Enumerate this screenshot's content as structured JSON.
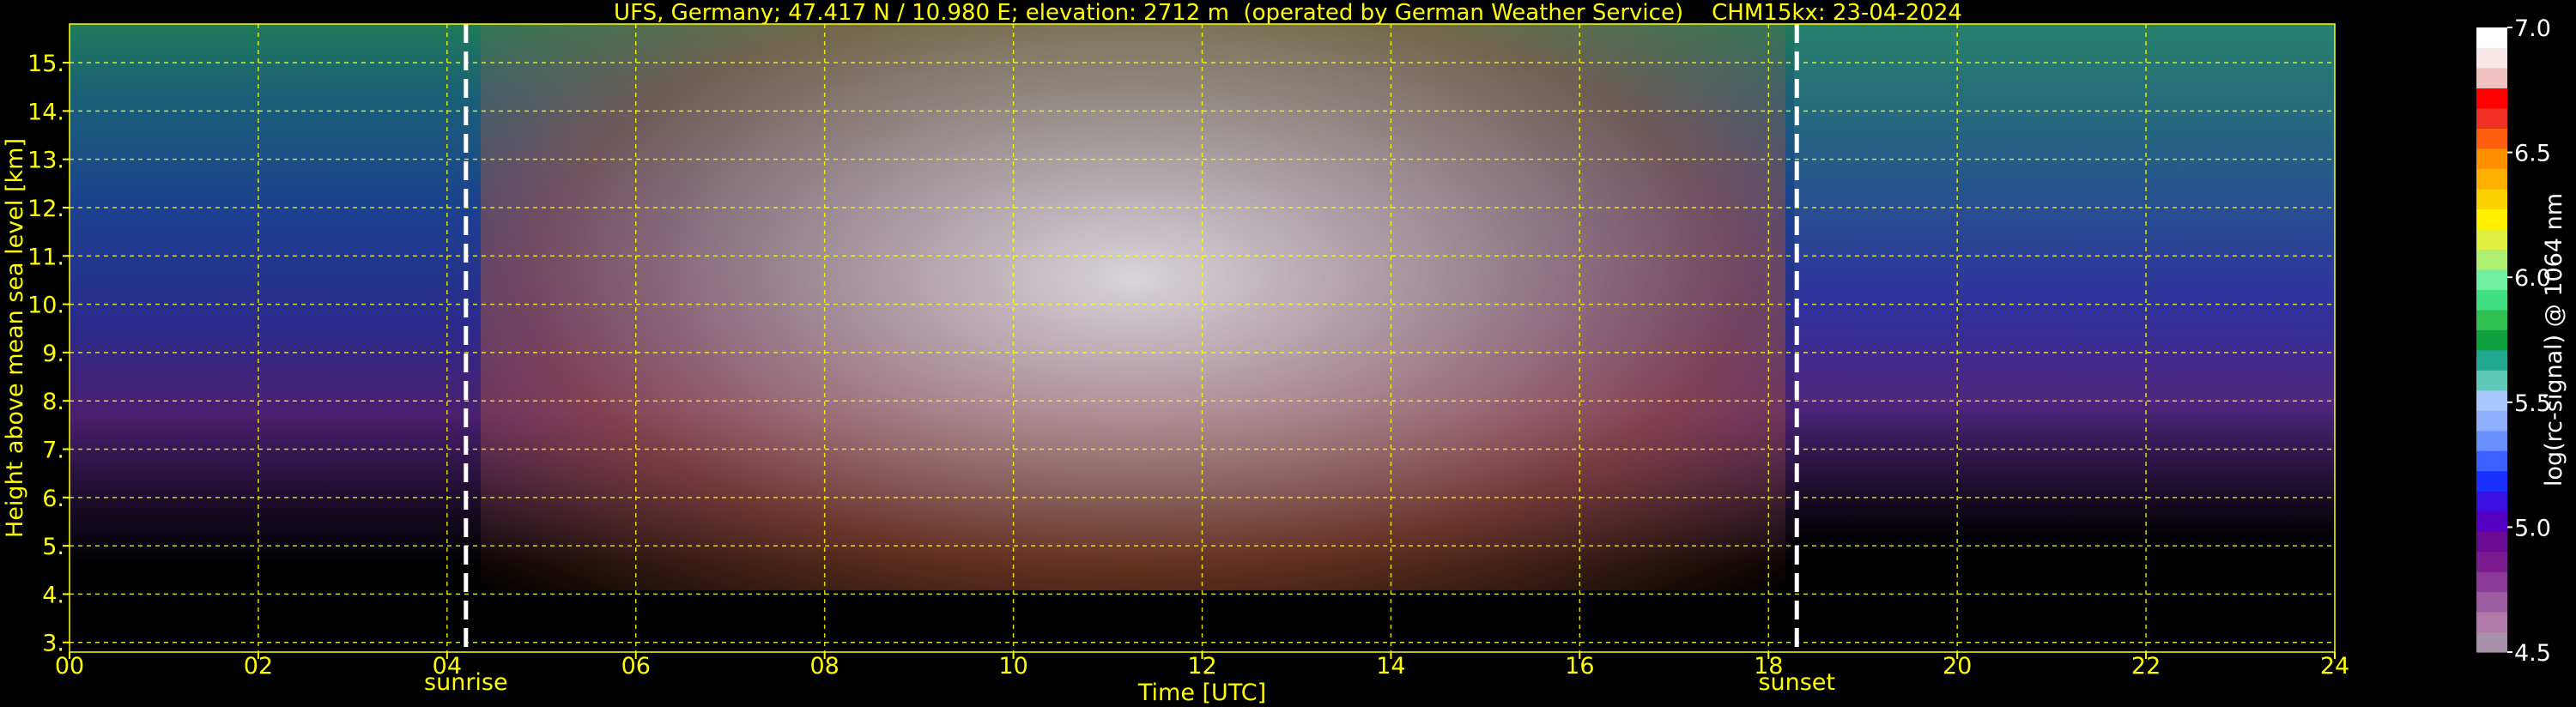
{
  "chart_data": {
    "type": "heatmap",
    "title": "UFS, Germany; 47.417 N / 10.980 E; elevation: 2712 m  (operated by German Weather Service)    CHM15kx: 23-04-2024",
    "xlabel": "Time [UTC]",
    "ylabel": "Height above mean sea level [km]",
    "xlim": [
      0,
      24
    ],
    "ylim": [
      2.8,
      15.8
    ],
    "xticks": [
      {
        "value": 0,
        "label": "00"
      },
      {
        "value": 2,
        "label": "02"
      },
      {
        "value": 4,
        "label": "04"
      },
      {
        "value": 6,
        "label": "06"
      },
      {
        "value": 8,
        "label": "08"
      },
      {
        "value": 10,
        "label": "10"
      },
      {
        "value": 12,
        "label": "12"
      },
      {
        "value": 14,
        "label": "14"
      },
      {
        "value": 16,
        "label": "16"
      },
      {
        "value": 18,
        "label": "18"
      },
      {
        "value": 20,
        "label": "20"
      },
      {
        "value": 22,
        "label": "22"
      },
      {
        "value": 24,
        "label": "24"
      }
    ],
    "yticks": [
      {
        "value": 3,
        "label": "3."
      },
      {
        "value": 4,
        "label": "4."
      },
      {
        "value": 5,
        "label": "5."
      },
      {
        "value": 6,
        "label": "6."
      },
      {
        "value": 7,
        "label": "7."
      },
      {
        "value": 8,
        "label": "8."
      },
      {
        "value": 9,
        "label": "9."
      },
      {
        "value": 10,
        "label": "10."
      },
      {
        "value": 11,
        "label": "11."
      },
      {
        "value": 12,
        "label": "12."
      },
      {
        "value": 13,
        "label": "13."
      },
      {
        "value": 14,
        "label": "14."
      },
      {
        "value": 15,
        "label": "15."
      }
    ],
    "grid": true,
    "annotations": [
      {
        "label": "sunrise",
        "time": 4.2
      },
      {
        "label": "sunset",
        "time": 18.3
      }
    ],
    "colorbar": {
      "label": "log(rc-signal) @ 1064 nm",
      "range": [
        4.5,
        7.0
      ],
      "ticks": [
        {
          "value": 4.5,
          "label": "4.5"
        },
        {
          "value": 5.0,
          "label": "5.0"
        },
        {
          "value": 5.5,
          "label": "5.5"
        },
        {
          "value": 6.0,
          "label": "6.0"
        },
        {
          "value": 6.5,
          "label": "6.5"
        },
        {
          "value": 7.0,
          "label": "7.0"
        }
      ],
      "colors": [
        "#a890a8",
        "#b07aa8",
        "#9a5ea0",
        "#8a3a98",
        "#7a1a8e",
        "#6a0a90",
        "#5500c0",
        "#3a10e0",
        "#1a30ff",
        "#3a60ff",
        "#6a90ff",
        "#90b0ff",
        "#a8c8ff",
        "#60c8b8",
        "#20a890",
        "#10a040",
        "#30c050",
        "#40e080",
        "#70f0a0",
        "#b0f070",
        "#e0f040",
        "#fff000",
        "#ffd000",
        "#ffb000",
        "#ff9000",
        "#ff6010",
        "#f03020",
        "#ff0000",
        "#f0c0c0",
        "#f8e8e8",
        "#ffffff"
      ]
    },
    "colors": {
      "text": "#ffff00",
      "grid": "#ffff00",
      "marker": "#ffffff",
      "background": "#000000"
    }
  }
}
